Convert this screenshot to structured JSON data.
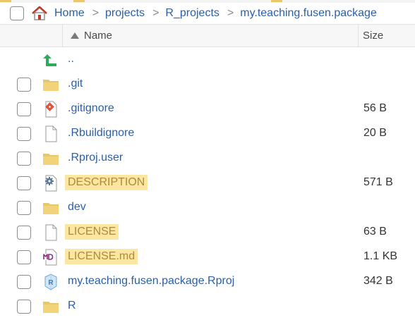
{
  "breadcrumb": {
    "items": [
      "Home",
      "projects",
      "R_projects",
      "my.teaching.fusen.package"
    ],
    "separator": ">"
  },
  "columns": {
    "name": "Name",
    "size": "Size"
  },
  "files": [
    {
      "name": "..",
      "size": "",
      "icon": "up-arrow-icon",
      "highlighted": false
    },
    {
      "name": ".git",
      "size": "",
      "icon": "folder-icon",
      "highlighted": false
    },
    {
      "name": ".gitignore",
      "size": "56 B",
      "icon": "git-file-icon",
      "highlighted": false
    },
    {
      "name": ".Rbuildignore",
      "size": "20 B",
      "icon": "file-icon",
      "highlighted": false
    },
    {
      "name": ".Rproj.user",
      "size": "",
      "icon": "folder-icon",
      "highlighted": false
    },
    {
      "name": "DESCRIPTION",
      "size": "571 B",
      "icon": "gear-file-icon",
      "highlighted": true
    },
    {
      "name": "dev",
      "size": "",
      "icon": "folder-icon",
      "highlighted": false
    },
    {
      "name": "LICENSE",
      "size": "63 B",
      "icon": "file-icon",
      "highlighted": true
    },
    {
      "name": "LICENSE.md",
      "size": "1.1 KB",
      "icon": "markdown-file-icon",
      "highlighted": true
    },
    {
      "name": "my.teaching.fusen.package.Rproj",
      "size": "342 B",
      "icon": "rproj-file-icon",
      "highlighted": false
    },
    {
      "name": "R",
      "size": "",
      "icon": "folder-icon",
      "highlighted": false
    }
  ],
  "colors": {
    "link": "#2a5fa8",
    "highlight": "#fbe7a1",
    "folder": "#e7c66c",
    "home_roof": "#c0392b"
  }
}
